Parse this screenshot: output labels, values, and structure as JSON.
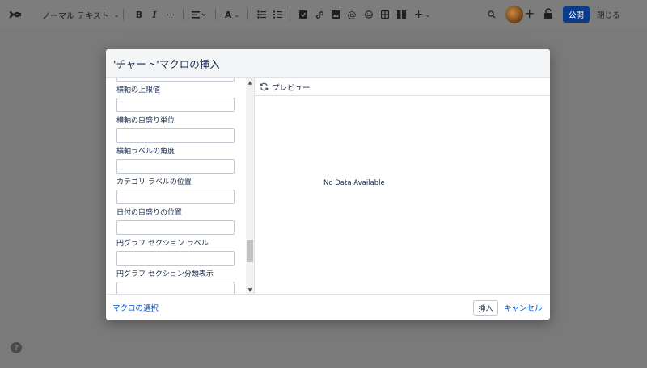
{
  "toolbar": {
    "text_style": "ノーマル テキスト",
    "bold": "B",
    "italic": "I",
    "more_format": "···",
    "text_color": "A",
    "more_insert": "+",
    "publish_label": "公開",
    "close_label": "閉じる"
  },
  "dialog": {
    "title": "'チャート'マクロの挿入",
    "fields": [
      {
        "label": "横軸の上限値",
        "value": ""
      },
      {
        "label": "横軸の目盛り単位",
        "value": ""
      },
      {
        "label": "横軸ラベルの角度",
        "value": ""
      },
      {
        "label": "カテゴリ ラベルの位置",
        "value": ""
      },
      {
        "label": "日付の目盛りの位置",
        "value": ""
      },
      {
        "label": "円グラフ セクション ラベル",
        "value": ""
      },
      {
        "label": "円グラフ セクション分類表示",
        "value": ""
      }
    ],
    "preview_label": "プレビュー",
    "no_data": "No Data Available",
    "select_macro_link": "マクロの選択",
    "insert_button": "挿入",
    "cancel_link": "キャンセル"
  },
  "help": "?",
  "colors": {
    "primary": "#0b3c8c",
    "link": "#0052cc",
    "overlay": "#7a7a7a"
  }
}
